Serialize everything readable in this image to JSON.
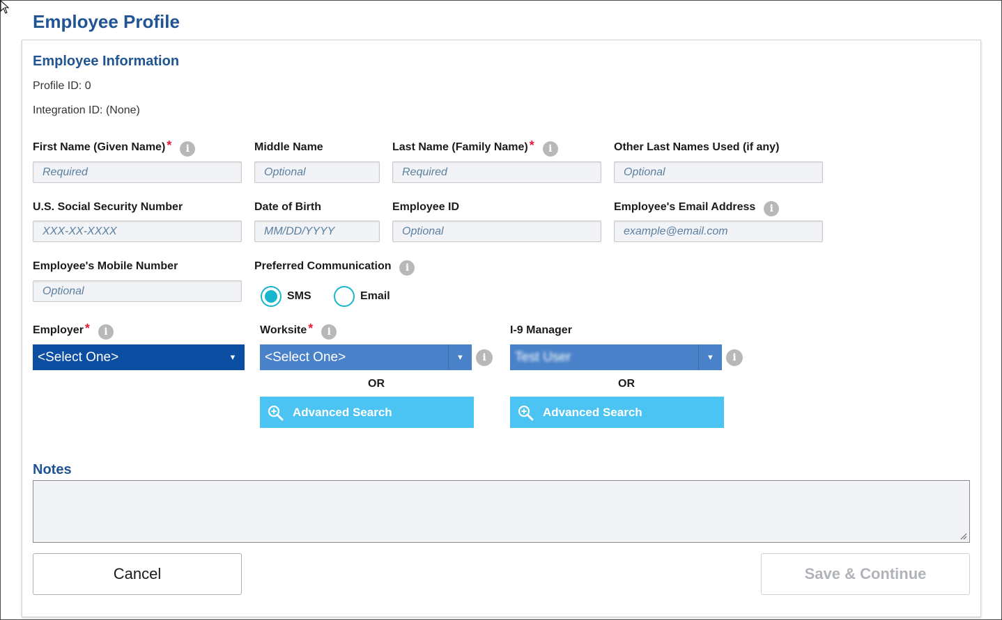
{
  "page": {
    "title": "Employee Profile"
  },
  "section": {
    "title": "Employee Information",
    "profile_id": "Profile ID: 0",
    "integration_id": "Integration ID: (None)"
  },
  "fields": {
    "first_name": {
      "label": "First Name (Given Name)",
      "placeholder": "Required",
      "required": true
    },
    "middle_name": {
      "label": "Middle Name",
      "placeholder": "Optional"
    },
    "last_name": {
      "label": "Last Name (Family Name)",
      "placeholder": "Required",
      "required": true
    },
    "other_last_names": {
      "label": "Other Last Names Used (if any)",
      "placeholder": "Optional"
    },
    "ssn": {
      "label": "U.S. Social Security Number",
      "placeholder": "XXX-XX-XXXX"
    },
    "dob": {
      "label": "Date of Birth",
      "placeholder": "MM/DD/YYYY"
    },
    "employee_id": {
      "label": "Employee ID",
      "placeholder": "Optional"
    },
    "email": {
      "label": "Employee's Email Address",
      "placeholder": "example@email.com"
    },
    "mobile": {
      "label": "Employee's Mobile Number",
      "placeholder": "Optional"
    }
  },
  "communication": {
    "label": "Preferred Communication",
    "options": [
      {
        "label": "SMS",
        "selected": true
      },
      {
        "label": "Email",
        "selected": false
      }
    ]
  },
  "employer": {
    "label": "Employer",
    "value": "<Select One>",
    "required": true
  },
  "worksite": {
    "label": "Worksite",
    "value": "<Select One>",
    "required": true,
    "or": "OR",
    "advanced_search": "Advanced Search"
  },
  "i9_manager": {
    "label": "I-9 Manager",
    "value": "Test User",
    "or": "OR",
    "advanced_search": "Advanced Search"
  },
  "notes": {
    "label": "Notes",
    "value": ""
  },
  "buttons": {
    "cancel": "Cancel",
    "save": "Save & Continue"
  },
  "colors": {
    "heading": "#205493",
    "primary_select": "#0b4ea2",
    "secondary_select": "#4a82c9",
    "advanced_search": "#4bc3f3",
    "radio": "#17b6cc",
    "required": "#e31c3d"
  },
  "icons": {
    "info": "info-icon",
    "search": "magnify-plus-icon",
    "caret": "caret-down-icon",
    "cursor": "cursor-arrow-icon"
  }
}
